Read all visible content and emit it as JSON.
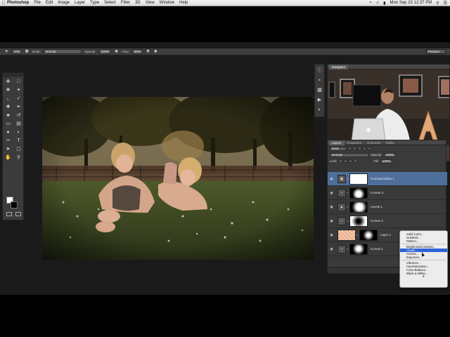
{
  "menubar": {
    "apple": "",
    "app_name": "Photoshop",
    "items": [
      "File",
      "Edit",
      "Image",
      "Layer",
      "Type",
      "Select",
      "Filter",
      "3D",
      "View",
      "Window",
      "Help"
    ],
    "clock": "Mon Sep 23  12:37 PM"
  },
  "options_bar": {
    "mode_label": "Mode:",
    "mode_value": "Normal",
    "opacity_label": "Opacity:",
    "opacity_value": "100%",
    "flow_label": "Flow:",
    "flow_value": "20%",
    "brush_size": "475",
    "workspace": "Pictures"
  },
  "navigator": {
    "tab_label": "Navigator"
  },
  "layers_panel": {
    "tabs": [
      "Layers",
      "Properties",
      "Channels",
      "Paths"
    ],
    "filter_kind": "Kind",
    "blend_mode": "Normal",
    "opacity_label": "Opacity:",
    "opacity_value": "100%",
    "lock_label": "Lock:",
    "fill_label": "Fill:",
    "fill_value": "100%",
    "layers": [
      {
        "name": "Hue/Saturation 1",
        "type": "adjustment",
        "selected": true
      },
      {
        "name": "Curves 3",
        "type": "adjustment",
        "selected": false
      },
      {
        "name": "Levels 1",
        "type": "adjustment",
        "selected": false
      },
      {
        "name": "Curves 2",
        "type": "adjustment",
        "selected": false
      },
      {
        "name": "Layer 1",
        "type": "pixel",
        "selected": false
      },
      {
        "name": "Curves 1",
        "type": "adjustment",
        "selected": false
      }
    ]
  },
  "adjustment_menu": {
    "items": [
      "Solid Color...",
      "Gradient...",
      "Pattern...",
      "-",
      "Brightness/Contrast...",
      "Levels...",
      "Curves...",
      "Exposure...",
      "-",
      "Vibrance...",
      "Hue/Saturation...",
      "Color Balance...",
      "Black & White..."
    ],
    "highlighted": "Levels..."
  },
  "colors": {
    "panel_bg": "#3a3a3a",
    "selected_layer": "#4f6f9b",
    "menu_highlight": "#2b63d8"
  }
}
